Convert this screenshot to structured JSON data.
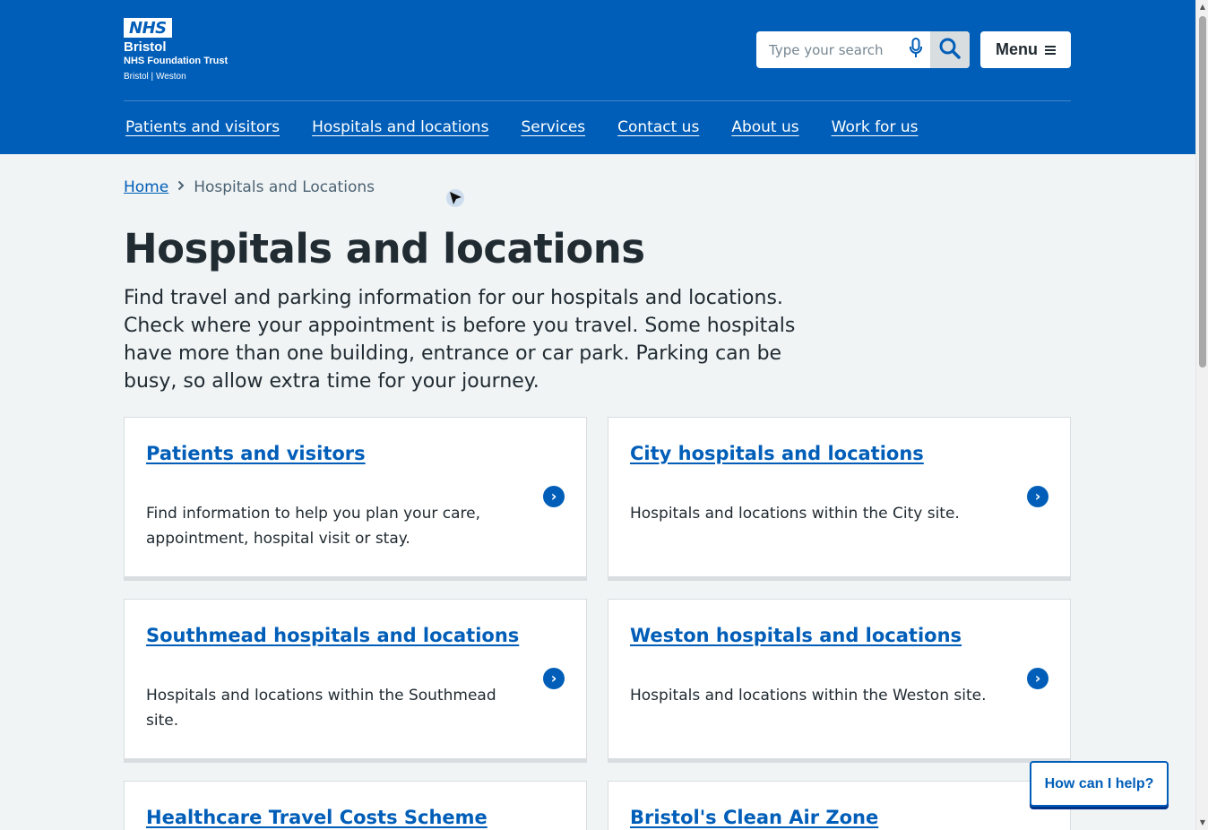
{
  "header": {
    "logo": {
      "nhs": "NHS",
      "org": "Bristol",
      "trust": "NHS Foundation Trust",
      "sites": "Bristol | Weston"
    },
    "search": {
      "placeholder": "Type your search",
      "value": ""
    },
    "menu_label": "Menu",
    "nav": [
      "Patients and visitors",
      "Hospitals and locations",
      "Services",
      "Contact us",
      "About us",
      "Work for us"
    ]
  },
  "breadcrumb": {
    "home": "Home",
    "current": "Hospitals and Locations"
  },
  "page": {
    "title": "Hospitals and locations",
    "lede": "Find travel and parking information for our hospitals and locations. Check where your appointment is before you travel. Some hospitals have more than one building, entrance or car park. Parking can be busy, so allow extra time for your journey."
  },
  "cards": [
    {
      "title": "Patients and visitors",
      "desc": "Find information to help you plan your care, appointment, hospital visit or stay."
    },
    {
      "title": "City hospitals and locations",
      "desc": "Hospitals and locations within the City site."
    },
    {
      "title": "Southmead hospitals and locations",
      "desc": "Hospitals and locations within the Southmead site."
    },
    {
      "title": "Weston hospitals and locations",
      "desc": "Hospitals and locations within the Weston site."
    },
    {
      "title": "Healthcare Travel Costs Scheme",
      "desc": ""
    },
    {
      "title": "Bristol's Clean Air Zone",
      "desc": ""
    }
  ],
  "help_button": "How can I help?",
  "colors": {
    "nhs_blue": "#005eb8",
    "background": "#f0f4f5",
    "text": "#212b32"
  }
}
